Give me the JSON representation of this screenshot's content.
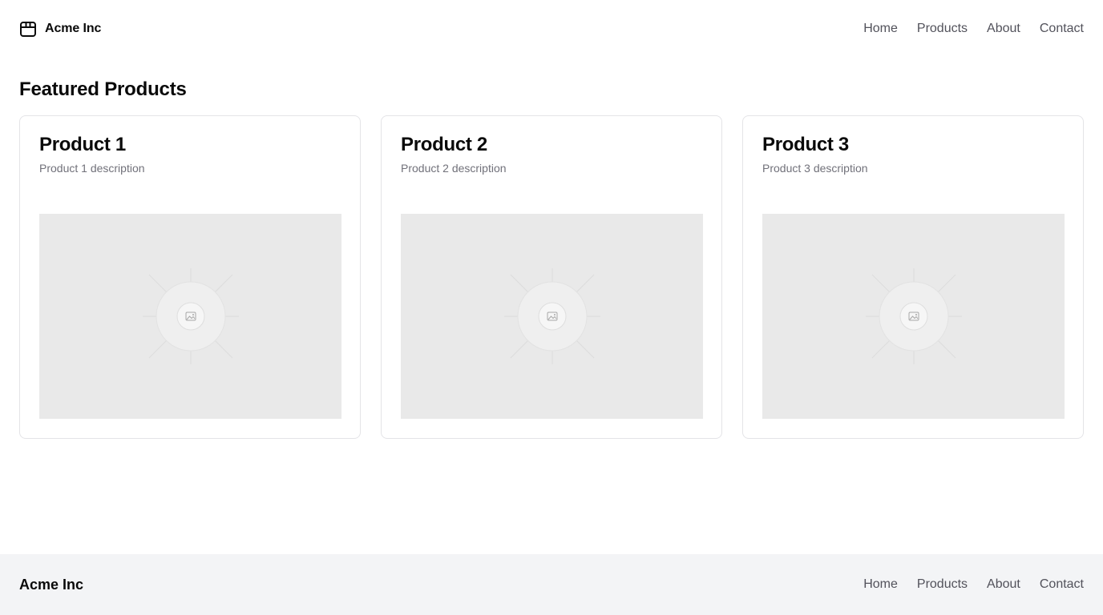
{
  "header": {
    "brand": {
      "name": "Acme Inc",
      "icon": "package-icon"
    },
    "nav": [
      {
        "label": "Home"
      },
      {
        "label": "Products"
      },
      {
        "label": "About"
      },
      {
        "label": "Contact"
      }
    ]
  },
  "main": {
    "title": "Featured Products",
    "products": [
      {
        "title": "Product 1",
        "description": "Product 1 description",
        "image_icon": "image-placeholder-icon"
      },
      {
        "title": "Product 2",
        "description": "Product 2 description",
        "image_icon": "image-placeholder-icon"
      },
      {
        "title": "Product 3",
        "description": "Product 3 description",
        "image_icon": "image-placeholder-icon"
      }
    ]
  },
  "footer": {
    "brand": "Acme Inc",
    "nav": [
      {
        "label": "Home"
      },
      {
        "label": "Products"
      },
      {
        "label": "About"
      },
      {
        "label": "Contact"
      }
    ]
  },
  "colors": {
    "text": "#0a0a0a",
    "muted": "#71717a",
    "nav": "#52525b",
    "border": "#e4e4e7",
    "placeholder_bg": "#e9e9e9",
    "footer_bg": "#f3f4f6"
  }
}
